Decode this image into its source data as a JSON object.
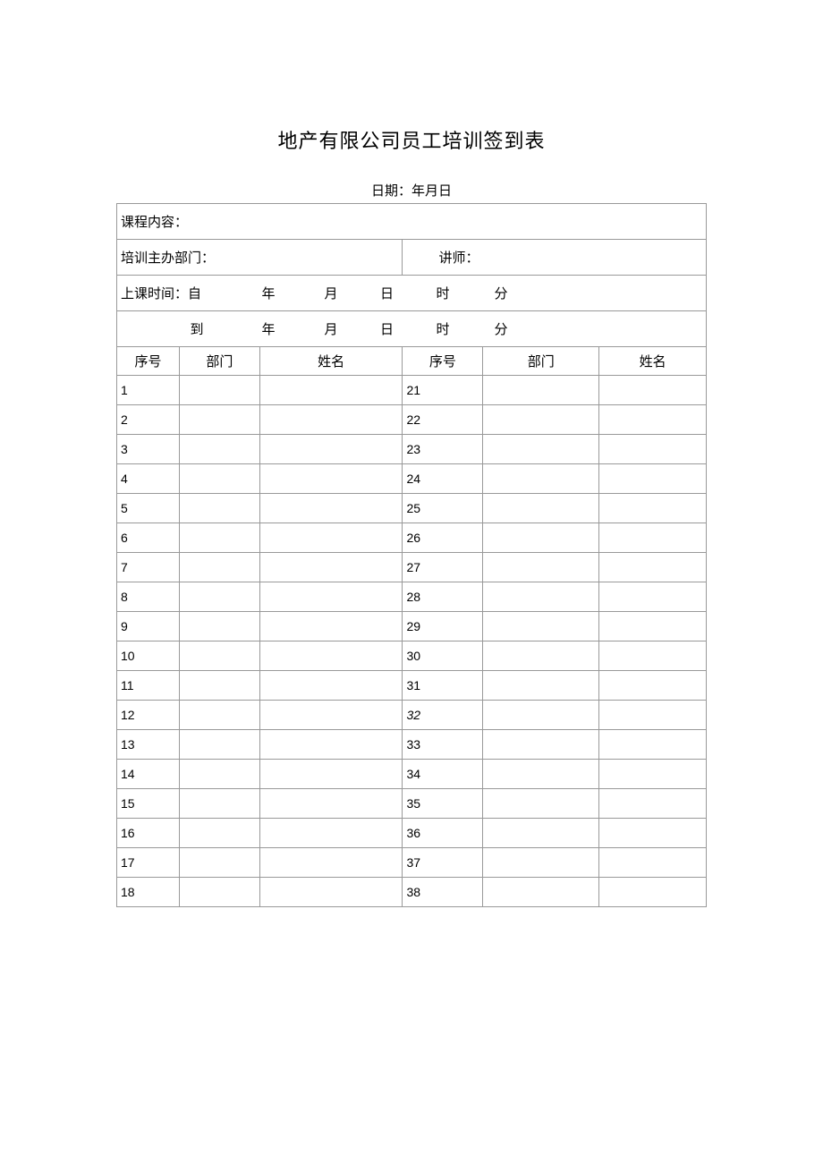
{
  "title": "地产有限公司员工培训签到表",
  "dateLine": "日期：年月日",
  "labels": {
    "courseContent": "课程内容：",
    "hostDept": "培训主办部门：",
    "instructor": "讲师：",
    "classTimeFrom": "上课时间：自",
    "to": "到",
    "year": "年",
    "month": "月",
    "day": "日",
    "hour": "时",
    "minute": "分"
  },
  "headers": {
    "seq": "序号",
    "dept": "部门",
    "name": "姓名"
  },
  "rows": [
    {
      "left": "1",
      "right": "21",
      "italic": false
    },
    {
      "left": "2",
      "right": "22",
      "italic": false
    },
    {
      "left": "3",
      "right": "23",
      "italic": false
    },
    {
      "left": "4",
      "right": "24",
      "italic": false
    },
    {
      "left": "5",
      "right": "25",
      "italic": false
    },
    {
      "left": "6",
      "right": "26",
      "italic": false
    },
    {
      "left": "7",
      "right": "27",
      "italic": false
    },
    {
      "left": "8",
      "right": "28",
      "italic": false
    },
    {
      "left": "9",
      "right": "29",
      "italic": false
    },
    {
      "left": "10",
      "right": "30",
      "italic": false
    },
    {
      "left": "11",
      "right": "31",
      "italic": false
    },
    {
      "left": "12",
      "right": "32",
      "italic": true
    },
    {
      "left": "13",
      "right": "33",
      "italic": false
    },
    {
      "left": "14",
      "right": "34",
      "italic": false
    },
    {
      "left": "15",
      "right": "35",
      "italic": false
    },
    {
      "left": "16",
      "right": "36",
      "italic": false
    },
    {
      "left": "17",
      "right": "37",
      "italic": false
    },
    {
      "left": "18",
      "right": "38",
      "italic": false
    }
  ]
}
